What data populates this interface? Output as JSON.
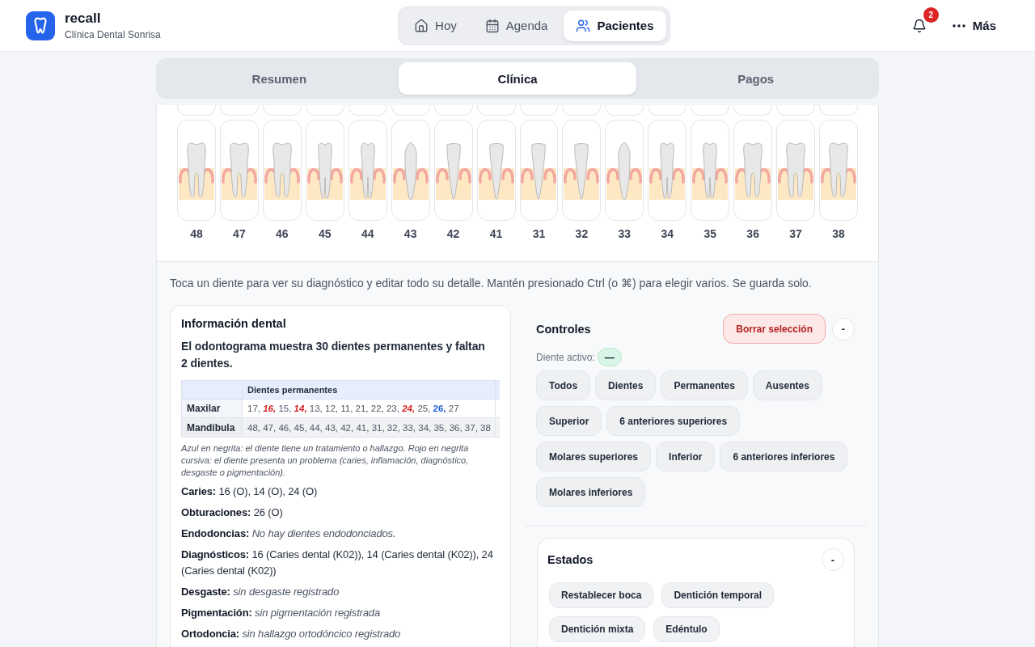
{
  "header": {
    "app_name": "recall",
    "clinic": "Clínica Dental Sonrisa",
    "nav": [
      {
        "label": "Hoy",
        "selected": false
      },
      {
        "label": "Agenda",
        "selected": false
      },
      {
        "label": "Pacientes",
        "selected": true
      }
    ],
    "notifications": {
      "count": "2"
    },
    "more": {
      "label": "Más"
    }
  },
  "section_tabs": [
    {
      "label": "Resumen",
      "selected": false
    },
    {
      "label": "Clínica",
      "selected": true
    },
    {
      "label": "Pagos",
      "selected": false
    }
  ],
  "odontogram": {
    "upper_row_cut": true,
    "lower_row": [
      {
        "number": "48",
        "kind": "molar"
      },
      {
        "number": "47",
        "kind": "molar"
      },
      {
        "number": "46",
        "kind": "molar"
      },
      {
        "number": "45",
        "kind": "premolar"
      },
      {
        "number": "44",
        "kind": "premolar"
      },
      {
        "number": "43",
        "kind": "canine"
      },
      {
        "number": "42",
        "kind": "incisor"
      },
      {
        "number": "41",
        "kind": "incisor"
      },
      {
        "number": "31",
        "kind": "incisor"
      },
      {
        "number": "32",
        "kind": "incisor"
      },
      {
        "number": "33",
        "kind": "canine"
      },
      {
        "number": "34",
        "kind": "premolar"
      },
      {
        "number": "35",
        "kind": "premolar"
      },
      {
        "number": "36",
        "kind": "molar"
      },
      {
        "number": "37",
        "kind": "molar"
      },
      {
        "number": "38",
        "kind": "molar"
      }
    ]
  },
  "hint": "Toca un diente para ver su diagnóstico y editar todo su detalle. Mantén presionado Ctrl (o ⌘) para elegir varios. Se guarda solo.",
  "dental_info": {
    "title": "Información dental",
    "summary": "El odontograma muestra 30 dientes permanentes y faltan 2 dientes.",
    "table": {
      "columns": [
        {
          "label": "Dientes permanentes"
        }
      ],
      "clipped": true,
      "rows": [
        {
          "label": "Maxilar",
          "teeth": [
            {
              "text": "17,",
              "kind": "plain"
            },
            {
              "text": "16,",
              "kind": "problem"
            },
            {
              "text": "15,",
              "kind": "plain"
            },
            {
              "text": "14,",
              "kind": "problem"
            },
            {
              "text": "13,",
              "kind": "plain"
            },
            {
              "text": "12,",
              "kind": "plain"
            },
            {
              "text": "11,",
              "kind": "plain"
            },
            {
              "text": "21,",
              "kind": "plain"
            },
            {
              "text": "22,",
              "kind": "plain"
            },
            {
              "text": "23,",
              "kind": "plain"
            },
            {
              "text": "24,",
              "kind": "problem"
            },
            {
              "text": "25,",
              "kind": "plain"
            },
            {
              "text": "26,",
              "kind": "treated"
            },
            {
              "text": "27",
              "kind": "plain"
            }
          ]
        },
        {
          "label": "Mandíbula",
          "teeth": [
            {
              "text": "48,",
              "kind": "plain"
            },
            {
              "text": "47,",
              "kind": "plain"
            },
            {
              "text": "46,",
              "kind": "plain"
            },
            {
              "text": "45,",
              "kind": "plain"
            },
            {
              "text": "44,",
              "kind": "plain"
            },
            {
              "text": "43,",
              "kind": "plain"
            },
            {
              "text": "42,",
              "kind": "plain"
            },
            {
              "text": "41,",
              "kind": "plain"
            },
            {
              "text": "31,",
              "kind": "plain"
            },
            {
              "text": "32,",
              "kind": "plain"
            },
            {
              "text": "33,",
              "kind": "plain"
            },
            {
              "text": "34,",
              "kind": "plain"
            },
            {
              "text": "35,",
              "kind": "plain"
            },
            {
              "text": "36,",
              "kind": "plain"
            },
            {
              "text": "37,",
              "kind": "plain"
            },
            {
              "text": "38",
              "kind": "plain"
            }
          ]
        }
      ]
    },
    "legend": "Azul en negrita: el diente tiene un tratamiento o hallazgo. Rojo en negrita cursiva: el diente presenta un problema (caries, inflamación, diagnóstico, desgaste o pigmentación).",
    "findings": [
      {
        "label": "Caries:",
        "value": "16 (O), 14 (O), 24 (O)",
        "empty": false
      },
      {
        "label": "Obturaciones:",
        "value": "26 (O)",
        "empty": false
      },
      {
        "label": "Endodoncias:",
        "value": "No hay dientes endodonciados.",
        "empty": true
      },
      {
        "label": "Diagnósticos:",
        "value": "16 (Caries dental (K02)), 14 (Caries dental (K02)), 24 (Caries dental (K02))",
        "empty": false
      },
      {
        "label": "Desgaste:",
        "value": "sin desgaste registrado",
        "empty": true
      },
      {
        "label": "Pigmentación:",
        "value": "sin pigmentación registrada",
        "empty": true
      },
      {
        "label": "Ortodoncia:",
        "value": "sin hallazgo ortodóncico registrado",
        "empty": true
      }
    ]
  },
  "controls": {
    "title": "Controles",
    "clear_button": "Borrar selección",
    "collapse_button": "-",
    "active_tooth": {
      "label": "Diente activo:",
      "value": "—"
    },
    "quick_select": [
      "Todos",
      "Dientes",
      "Permanentes",
      "Ausentes",
      "Superior",
      "6 anteriores superiores",
      "Molares superiores",
      "Inferior",
      "6 anteriores inferiores",
      "Molares inferiores"
    ]
  },
  "states": {
    "title": "Estados",
    "collapse_button": "-",
    "actions": [
      "Restablecer boca",
      "Dentición temporal",
      "Dentición mixta",
      "Edéntulo"
    ]
  }
}
